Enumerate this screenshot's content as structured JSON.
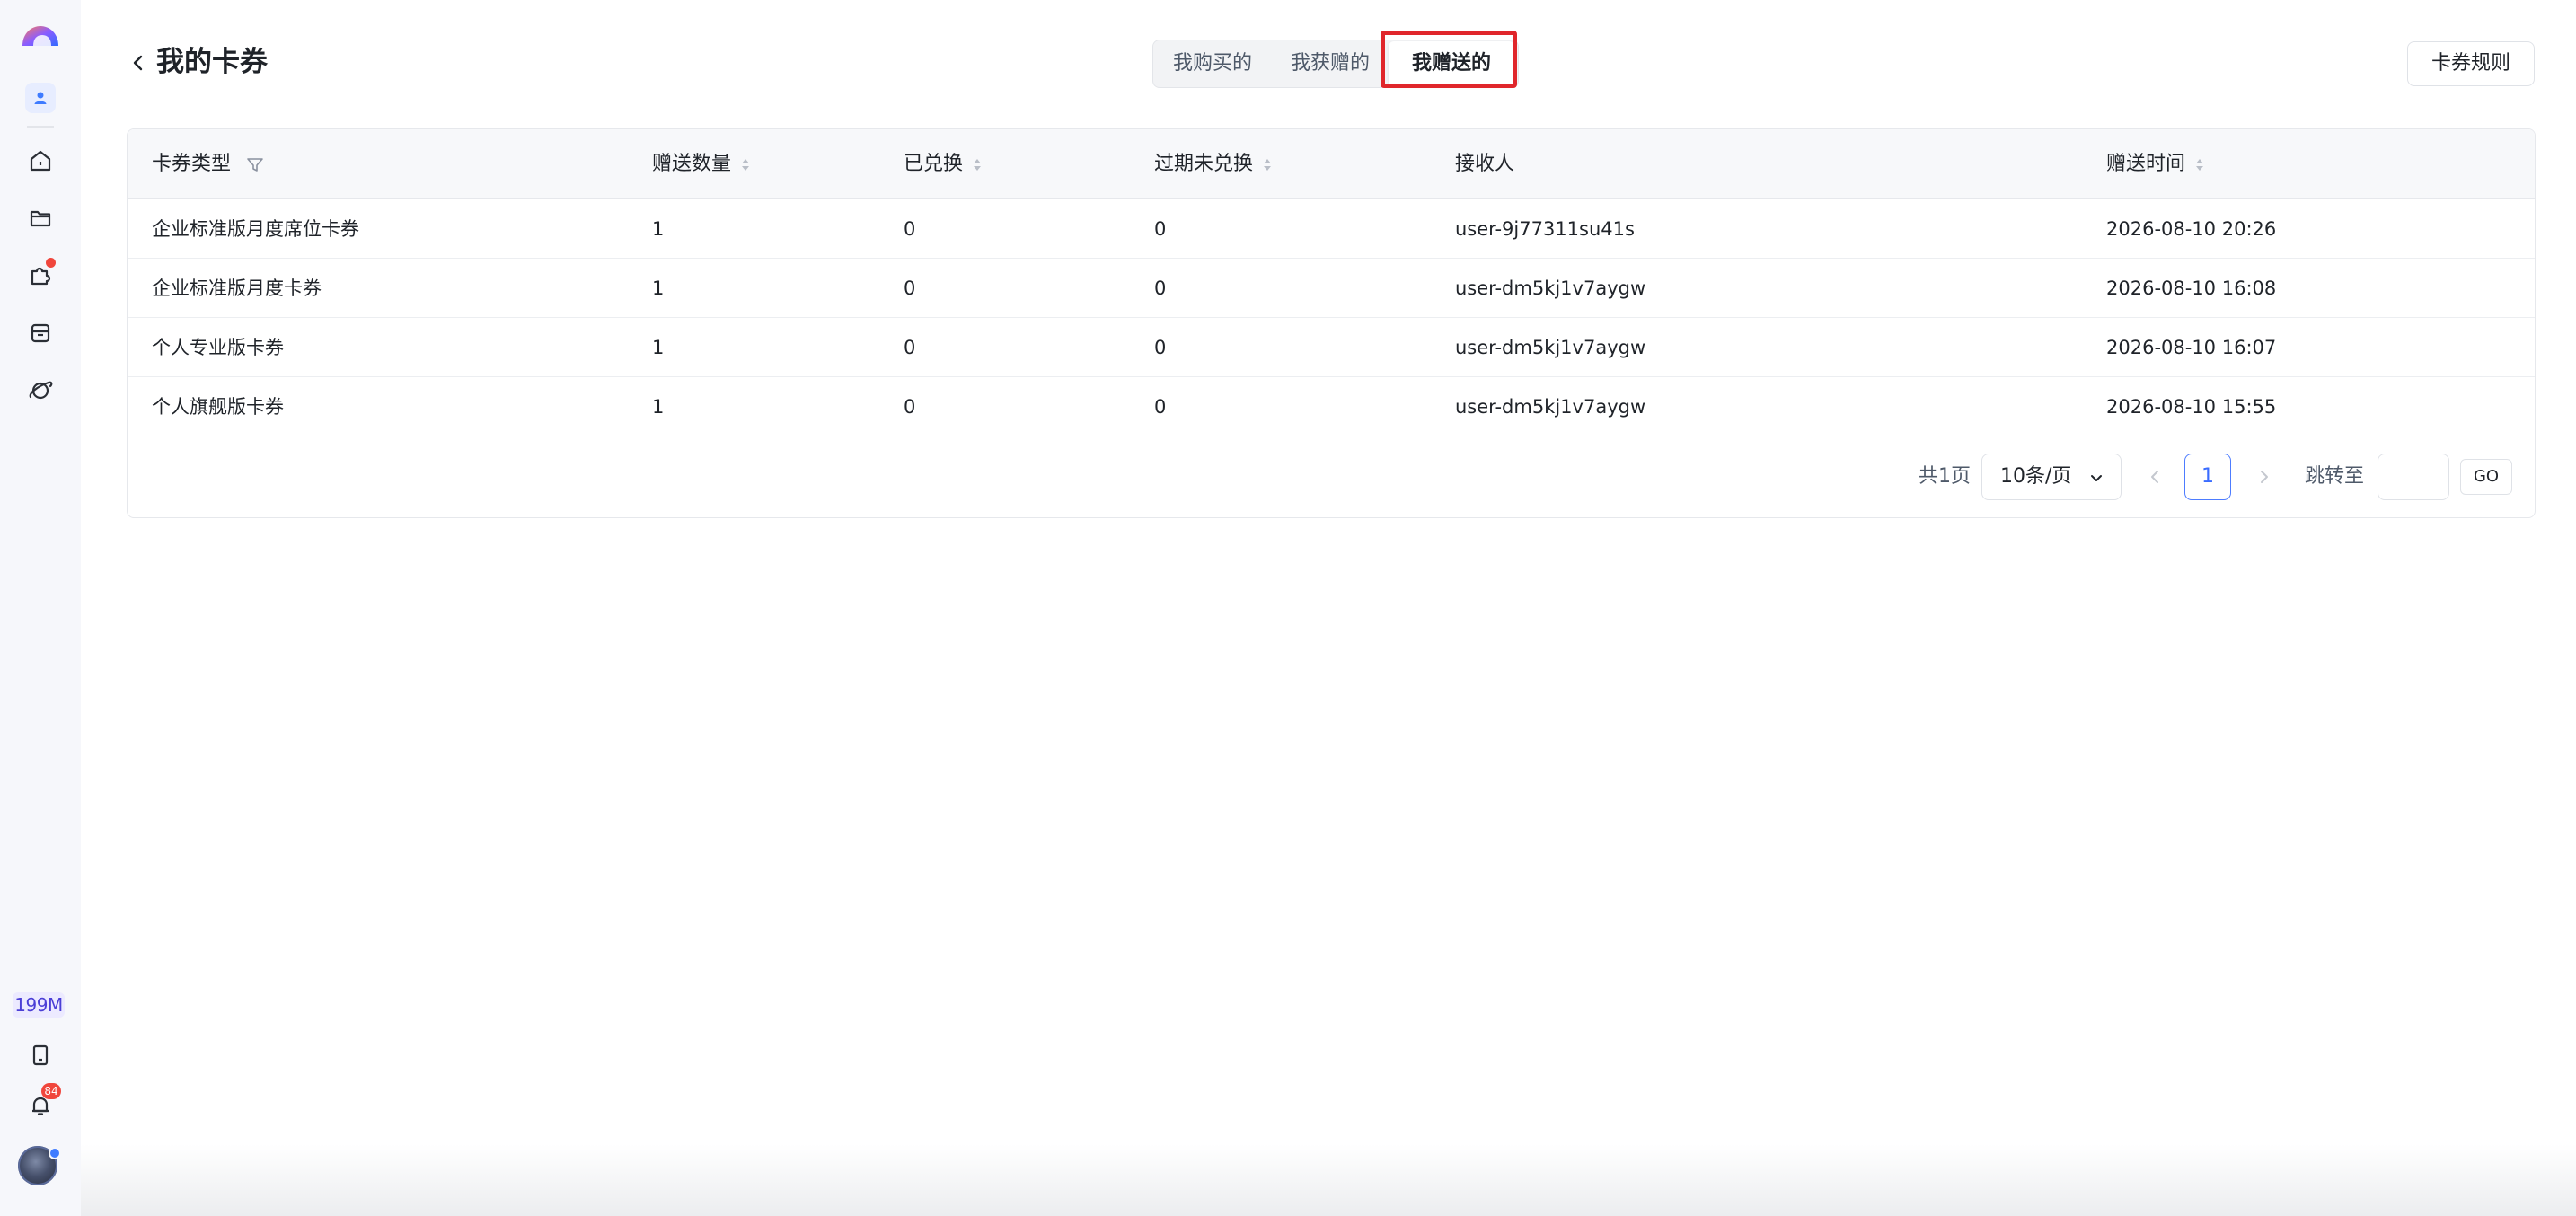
{
  "sidebar": {
    "items": [
      {
        "icon": "logo-icon"
      },
      {
        "icon": "user-icon"
      },
      {
        "icon": "home-icon"
      },
      {
        "icon": "folder-icon"
      },
      {
        "icon": "puzzle-icon",
        "has_dot": true
      },
      {
        "icon": "archive-box-icon"
      },
      {
        "icon": "planet-icon"
      }
    ],
    "storage_label": "199M",
    "bottom_items": [
      {
        "icon": "document-icon"
      },
      {
        "icon": "bell-icon",
        "badge": "84"
      }
    ]
  },
  "header": {
    "title": "我的卡券",
    "tabs": [
      {
        "label": "我购买的",
        "active": false
      },
      {
        "label": "我获赠的",
        "active": false
      },
      {
        "label": "我赠送的",
        "active": true
      }
    ],
    "rules_button": "卡券规则"
  },
  "table": {
    "columns": [
      {
        "label": "卡券类型",
        "filter": true,
        "sortable": false
      },
      {
        "label": "赠送数量",
        "sortable": true
      },
      {
        "label": "已兑换",
        "sortable": true
      },
      {
        "label": "过期未兑换",
        "sortable": true
      },
      {
        "label": "接收人",
        "sortable": false
      },
      {
        "label": "赠送时间",
        "sortable": true
      }
    ],
    "rows": [
      [
        "企业标准版月度席位卡券",
        "1",
        "0",
        "0",
        "user-9j77311su41s",
        "2026-08-10 20:26"
      ],
      [
        "企业标准版月度卡券",
        "1",
        "0",
        "0",
        "user-dm5kj1v7aygw",
        "2026-08-10 16:08"
      ],
      [
        "个人专业版卡券",
        "1",
        "0",
        "0",
        "user-dm5kj1v7aygw",
        "2026-08-10 16:07"
      ],
      [
        "个人旗舰版卡券",
        "1",
        "0",
        "0",
        "user-dm5kj1v7aygw",
        "2026-08-10 15:55"
      ]
    ]
  },
  "pagination": {
    "total_text": "共1页",
    "page_size": "10条/页",
    "current_page": "1",
    "jump_label": "跳转至",
    "jump_value": "",
    "go_label": "GO"
  },
  "colors": {
    "accent": "#3a6cff",
    "highlight": "#e0262b",
    "sidebar_bg": "#f6f7fb"
  }
}
